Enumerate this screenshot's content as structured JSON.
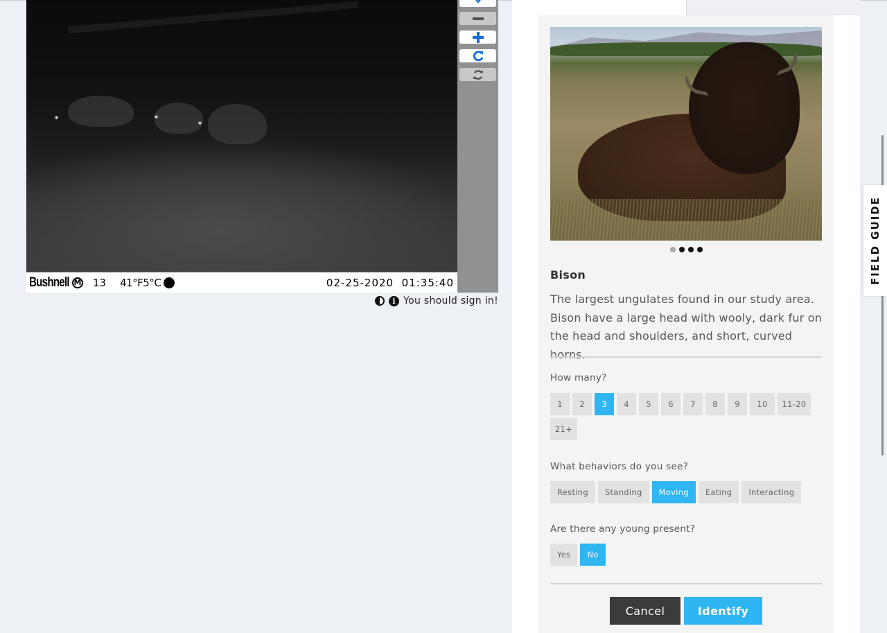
{
  "viewer": {
    "camera": {
      "brand": "Bushnell",
      "mode_badge": "M",
      "number": "13",
      "temperature": "41°F5°C",
      "datetime": "02-25-2020  01:35:40"
    },
    "toolbar": {
      "pan_icon": "chevron-down-icon",
      "zoom_out_icon": "minus-icon",
      "zoom_in_icon": "plus-icon",
      "rotate_icon": "rotate-icon",
      "reset_icon": "refresh-icon"
    },
    "signin_message": "You should sign in!"
  },
  "task": {
    "species_name": "Bison",
    "species_description": "The largest ungulates found in our study area. Bison have a large head with wooly, dark fur on the head and shoulders, and short, curved horns.",
    "carousel": {
      "total": 4,
      "active_index": 0
    },
    "questions": {
      "how_many": {
        "label": "How many?",
        "options": [
          "1",
          "2",
          "3",
          "4",
          "5",
          "6",
          "7",
          "8",
          "9",
          "10",
          "11-20",
          "21+"
        ],
        "selected": "3"
      },
      "behaviors": {
        "label": "What behaviors do you see?",
        "options": [
          "Resting",
          "Standing",
          "Moving",
          "Eating",
          "Interacting"
        ],
        "selected": [
          "Moving"
        ]
      },
      "young": {
        "label": "Are there any young present?",
        "options": [
          "Yes",
          "No"
        ],
        "selected": "No"
      }
    },
    "buttons": {
      "cancel": "Cancel",
      "identify": "Identify"
    }
  },
  "field_guide": {
    "label": "FIELD GUIDE"
  },
  "colors": {
    "accent": "#2fb6f2",
    "cancel": "#3b3b3b",
    "panel": "#f4f4f4",
    "page": "#edf0f4"
  }
}
